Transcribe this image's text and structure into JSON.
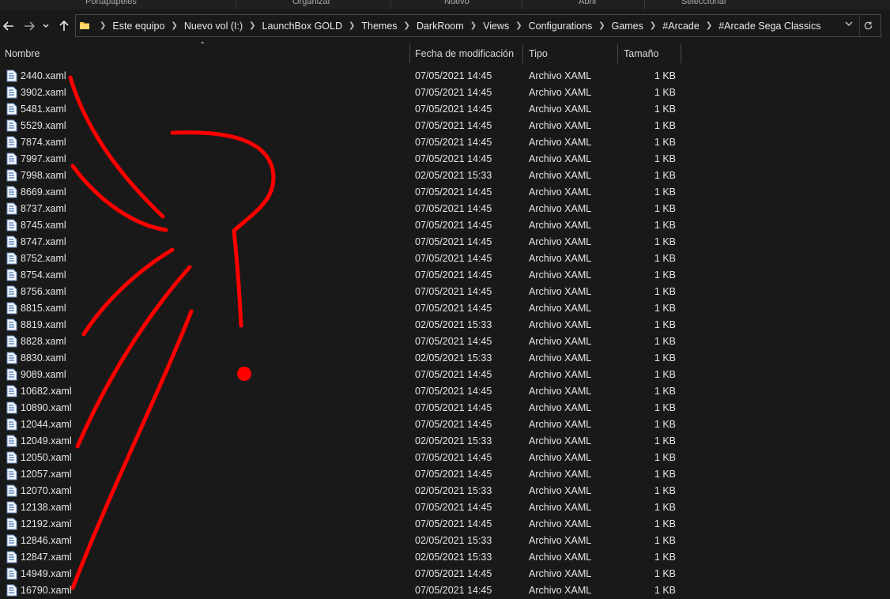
{
  "ribbon": {
    "groups": [
      "Portapapeles",
      "Organizar",
      "Nuevo",
      "Abrir",
      "Seleccionar"
    ]
  },
  "nav": {
    "back_icon": "arrow-left-icon",
    "forward_icon": "arrow-right-icon",
    "recent_icon": "chevron-down-icon",
    "up_icon": "arrow-up-icon"
  },
  "address": {
    "crumbs": [
      "Este equipo",
      "Nuevo vol (I:)",
      "LaunchBox GOLD",
      "Themes",
      "DarkRoom",
      "Views",
      "Configurations",
      "Games",
      "#Arcade",
      "#Arcade Sega Classics"
    ]
  },
  "columns": {
    "name": "Nombre",
    "date": "Fecha de modificación",
    "type": "Tipo",
    "size": "Tamaño"
  },
  "files": [
    {
      "name": "2440.xaml",
      "date": "07/05/2021 14:45",
      "type": "Archivo XAML",
      "size": "1 KB"
    },
    {
      "name": "3902.xaml",
      "date": "07/05/2021 14:45",
      "type": "Archivo XAML",
      "size": "1 KB"
    },
    {
      "name": "5481.xaml",
      "date": "07/05/2021 14:45",
      "type": "Archivo XAML",
      "size": "1 KB"
    },
    {
      "name": "5529.xaml",
      "date": "07/05/2021 14:45",
      "type": "Archivo XAML",
      "size": "1 KB"
    },
    {
      "name": "7874.xaml",
      "date": "07/05/2021 14:45",
      "type": "Archivo XAML",
      "size": "1 KB"
    },
    {
      "name": "7997.xaml",
      "date": "07/05/2021 14:45",
      "type": "Archivo XAML",
      "size": "1 KB"
    },
    {
      "name": "7998.xaml",
      "date": "02/05/2021 15:33",
      "type": "Archivo XAML",
      "size": "1 KB"
    },
    {
      "name": "8669.xaml",
      "date": "07/05/2021 14:45",
      "type": "Archivo XAML",
      "size": "1 KB"
    },
    {
      "name": "8737.xaml",
      "date": "07/05/2021 14:45",
      "type": "Archivo XAML",
      "size": "1 KB"
    },
    {
      "name": "8745.xaml",
      "date": "07/05/2021 14:45",
      "type": "Archivo XAML",
      "size": "1 KB"
    },
    {
      "name": "8747.xaml",
      "date": "07/05/2021 14:45",
      "type": "Archivo XAML",
      "size": "1 KB"
    },
    {
      "name": "8752.xaml",
      "date": "07/05/2021 14:45",
      "type": "Archivo XAML",
      "size": "1 KB"
    },
    {
      "name": "8754.xaml",
      "date": "07/05/2021 14:45",
      "type": "Archivo XAML",
      "size": "1 KB"
    },
    {
      "name": "8756.xaml",
      "date": "07/05/2021 14:45",
      "type": "Archivo XAML",
      "size": "1 KB"
    },
    {
      "name": "8815.xaml",
      "date": "07/05/2021 14:45",
      "type": "Archivo XAML",
      "size": "1 KB"
    },
    {
      "name": "8819.xaml",
      "date": "02/05/2021 15:33",
      "type": "Archivo XAML",
      "size": "1 KB"
    },
    {
      "name": "8828.xaml",
      "date": "07/05/2021 14:45",
      "type": "Archivo XAML",
      "size": "1 KB"
    },
    {
      "name": "8830.xaml",
      "date": "02/05/2021 15:33",
      "type": "Archivo XAML",
      "size": "1 KB"
    },
    {
      "name": "9089.xaml",
      "date": "07/05/2021 14:45",
      "type": "Archivo XAML",
      "size": "1 KB"
    },
    {
      "name": "10682.xaml",
      "date": "07/05/2021 14:45",
      "type": "Archivo XAML",
      "size": "1 KB"
    },
    {
      "name": "10890.xaml",
      "date": "07/05/2021 14:45",
      "type": "Archivo XAML",
      "size": "1 KB"
    },
    {
      "name": "12044.xaml",
      "date": "07/05/2021 14:45",
      "type": "Archivo XAML",
      "size": "1 KB"
    },
    {
      "name": "12049.xaml",
      "date": "02/05/2021 15:33",
      "type": "Archivo XAML",
      "size": "1 KB"
    },
    {
      "name": "12050.xaml",
      "date": "07/05/2021 14:45",
      "type": "Archivo XAML",
      "size": "1 KB"
    },
    {
      "name": "12057.xaml",
      "date": "07/05/2021 14:45",
      "type": "Archivo XAML",
      "size": "1 KB"
    },
    {
      "name": "12070.xaml",
      "date": "02/05/2021 15:33",
      "type": "Archivo XAML",
      "size": "1 KB"
    },
    {
      "name": "12138.xaml",
      "date": "07/05/2021 14:45",
      "type": "Archivo XAML",
      "size": "1 KB"
    },
    {
      "name": "12192.xaml",
      "date": "07/05/2021 14:45",
      "type": "Archivo XAML",
      "size": "1 KB"
    },
    {
      "name": "12846.xaml",
      "date": "02/05/2021 15:33",
      "type": "Archivo XAML",
      "size": "1 KB"
    },
    {
      "name": "12847.xaml",
      "date": "02/05/2021 15:33",
      "type": "Archivo XAML",
      "size": "1 KB"
    },
    {
      "name": "14949.xaml",
      "date": "07/05/2021 14:45",
      "type": "Archivo XAML",
      "size": "1 KB"
    },
    {
      "name": "16790.xaml",
      "date": "07/05/2021 14:45",
      "type": "Archivo XAML",
      "size": "1 KB"
    }
  ],
  "colors": {
    "background": "#191919",
    "text": "#e6e6e6",
    "annotation": "#ff0000",
    "folder": "#f5c542"
  }
}
